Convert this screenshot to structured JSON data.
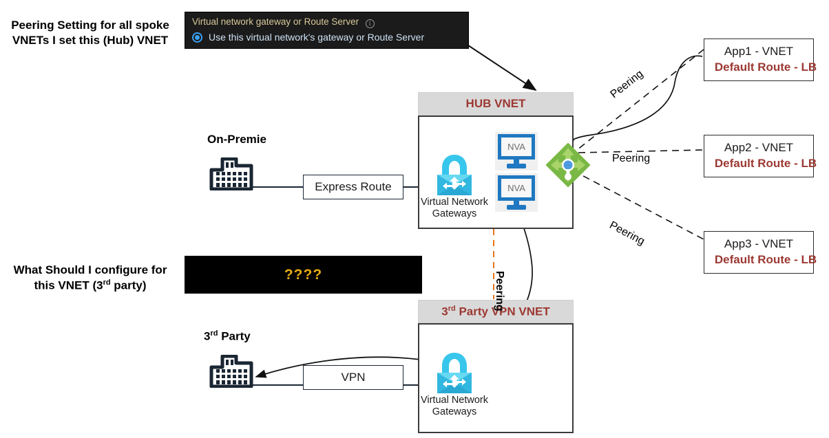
{
  "annotations": {
    "hub_note_line1": "Peering Setting for all spoke",
    "hub_note_line2": "VNETs I set this (Hub) VNET",
    "third_note_line1": "What Should I configure for",
    "third_note_line2_pre": "this VNET (3",
    "third_note_line2_sup": "rd",
    "third_note_line2_post": " party)"
  },
  "portal_setting": {
    "label": "Virtual network gateway or Route Server",
    "info_icon": "info-icon",
    "radio_selected_option": "Use this virtual network's gateway or Route Server"
  },
  "unknown_config": {
    "value": "????"
  },
  "hub_vnet": {
    "title": "HUB VNET",
    "gateway_caption_line1": "Virtual Network",
    "gateway_caption_line2": "Gateways",
    "gateway_icon": "virtual-network-gateway-icon",
    "nva_1_label": "NVA",
    "nva_2_label": "NVA",
    "nva_icon": "nva-monitor-icon",
    "load_balancer_icon": "load-balancer-icon"
  },
  "third_party_vnet": {
    "title_pre": "3",
    "title_sup": "rd",
    "title_post": " Party VPN VNET",
    "gateway_caption_line1": "Virtual Network",
    "gateway_caption_line2": "Gateways",
    "gateway_icon": "virtual-network-gateway-icon"
  },
  "on_premise": {
    "label": "On-Premie",
    "building_icon": "office-building-icon",
    "link_label": "Express Route"
  },
  "third_party_site": {
    "label_pre": "3",
    "label_sup": "rd",
    "label_post": " Party",
    "building_icon": "office-building-icon",
    "link_label": "VPN"
  },
  "spokes": [
    {
      "name": "App1 - VNET",
      "route": "Default Route - LB",
      "peering_label": "Peering"
    },
    {
      "name": "App2 - VNET",
      "route": "Default Route - LB",
      "peering_label": "Peering"
    },
    {
      "name": "App3 - VNET",
      "route": "Default Route - LB",
      "peering_label": "Peering"
    }
  ],
  "hub_to_third_peering": {
    "label": "Peering"
  },
  "colors": {
    "vnet_title": "#9c3832",
    "vnet_header_bg": "#d9d9d9",
    "portal_bg": "#1b1b1b",
    "portal_label": "#d9c89a",
    "accent_blue": "#3aa0f3",
    "question_yellow": "#e8ac16",
    "gateway_cyan": "#32c5ea",
    "nva_blue": "#1f78c1",
    "lb_green": "#7ab845",
    "peering_orange": "#e8751a"
  }
}
